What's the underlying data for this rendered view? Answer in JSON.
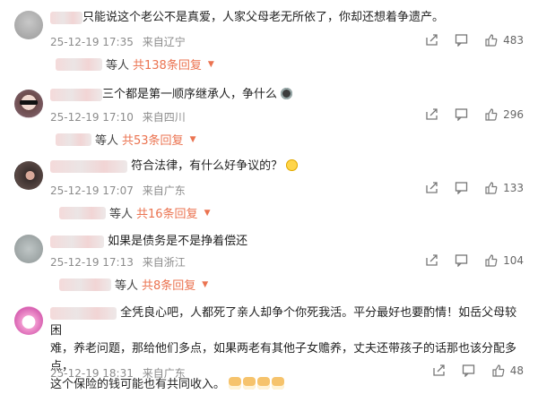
{
  "comments": [
    {
      "text": "只能说这个老公不是真爱，人家父母老无所依了，你却还想着争遗产。",
      "date": "25-12-19 17:35",
      "location": "来自辽宁",
      "likes": "483",
      "replies_prefix": "等人",
      "replies_count": "共138条回复",
      "avatar_icon": "avatar-gray-blur"
    },
    {
      "text": "三个都是第一顺序继承人，争什么",
      "date": "25-12-19 17:10",
      "location": "来自四川",
      "likes": "296",
      "replies_prefix": "等人",
      "replies_count": "共53条回复",
      "avatar_icon": "avatar-sunglasses"
    },
    {
      "text": "符合法律，有什么好争议的？",
      "date": "25-12-19 17:07",
      "location": "来自广东",
      "likes": "133",
      "replies_prefix": "等人",
      "replies_count": "共16条回复",
      "avatar_icon": "avatar-dark"
    },
    {
      "text": "如果是债务是不是挣着偿还",
      "date": "25-12-19 17:13",
      "location": "来自浙江",
      "likes": "104",
      "replies_prefix": "等人",
      "replies_count": "共8条回复",
      "avatar_icon": "avatar-gray"
    },
    {
      "text_line1": "全凭良心吧，人都死了亲人却争个你死我活。平分最好也要酌情！如岳父母较困",
      "text_line2": "难，养老问题，那给他们多点，如果两老有其他子女赡养，丈夫还带孩子的话那也该分配多点，",
      "text_line3": "这个保险的钱可能也有共同收入。",
      "date": "25-12-19 18:31",
      "location": "来自广东",
      "likes": "48",
      "avatar_icon": "avatar-pink-cartoon"
    }
  ],
  "icons": {
    "share": "share-icon",
    "comment": "comment-icon",
    "like": "thumbs-up-icon"
  },
  "colors": {
    "accent": "#eb7350",
    "meta": "#8c8c8c"
  }
}
